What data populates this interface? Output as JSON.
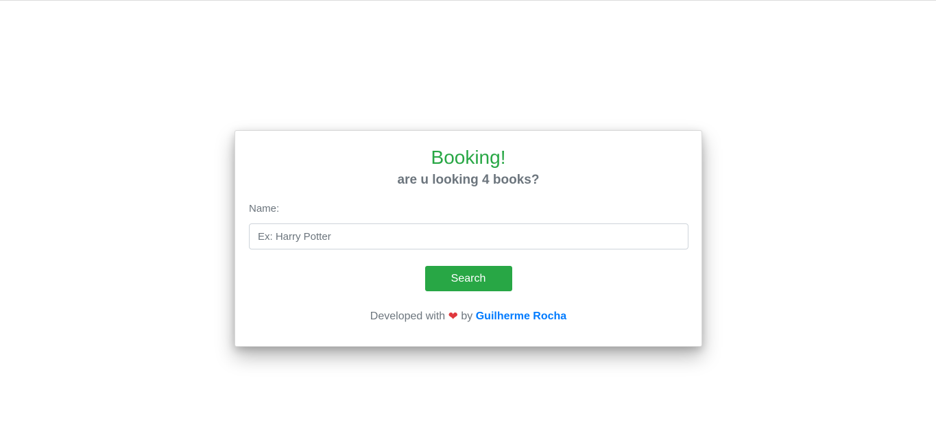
{
  "card": {
    "title": "Booking!",
    "subtitle": "are u looking 4 books?",
    "name_label": "Name:",
    "name_input": {
      "value": "",
      "placeholder": "Ex: Harry Potter"
    },
    "search_label": "Search"
  },
  "footer": {
    "prefix": "Developed with",
    "heart_icon": "heart-icon",
    "heart_glyph": "❤",
    "by": "by",
    "author": "Guilherme Rocha"
  },
  "colors": {
    "primary_green": "#28a745",
    "muted_text": "#6c757d",
    "link_blue": "#007bff",
    "heart_red": "#e0383e"
  }
}
